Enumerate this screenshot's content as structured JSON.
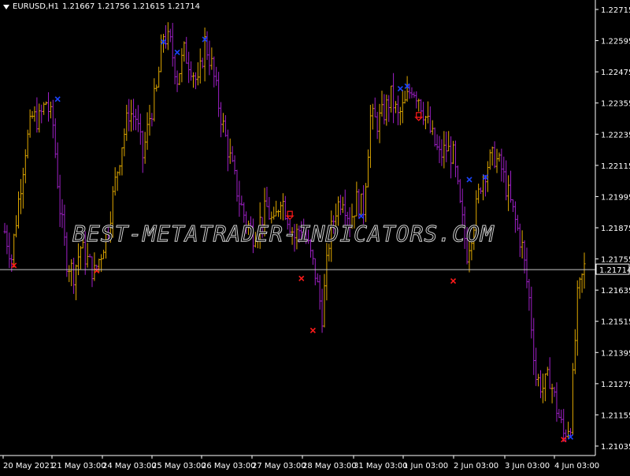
{
  "window": {
    "symbol": "EURUSD,H1",
    "ohlc": "1.21667 1.21756 1.21615 1.21714"
  },
  "watermark": "BEST-METATRADER-INDICATORS.COM",
  "price_axis": {
    "ticks": [
      "1.22715",
      "1.22595",
      "1.22475",
      "1.22355",
      "1.22235",
      "1.22115",
      "1.21995",
      "1.21875",
      "1.21755",
      "1.21635",
      "1.21515",
      "1.21395",
      "1.21275",
      "1.21155",
      "1.21035"
    ],
    "current_price_label": "1.21714"
  },
  "time_axis": {
    "ticks": [
      "20 May 2021",
      "21 May 03:00",
      "24 May 03:00",
      "25 May 03:00",
      "26 May 03:00",
      "27 May 03:00",
      "28 May 03:00",
      "31 May 03:00",
      "1 Jun 03:00",
      "2 Jun 03:00",
      "3 Jun 03:00",
      "4 Jun 03:00"
    ]
  },
  "colors": {
    "background": "#000000",
    "grid_text": "#ffffff",
    "bull_bar": "#e0a800",
    "bear_bar": "#a020c8",
    "current_line": "#c8c8c8",
    "sell_marker": "#ff1a1a",
    "buy_marker": "#1a44ff"
  },
  "chart_data": {
    "type": "bar",
    "title": "EURUSD,H1",
    "ylim": [
      1.21,
      1.2275
    ],
    "current_price": 1.21714,
    "xlabels": [
      "20 May 2021",
      "21 May 03:00",
      "24 May 03:00",
      "25 May 03:00",
      "26 May 03:00",
      "27 May 03:00",
      "28 May 03:00",
      "31 May 03:00",
      "1 Jun 03:00",
      "2 Jun 03:00",
      "3 Jun 03:00",
      "4 Jun 03:00"
    ],
    "close_path": [
      [
        0,
        1.2186
      ],
      [
        3,
        1.2176
      ],
      [
        6,
        1.2198
      ],
      [
        9,
        1.2218
      ],
      [
        12,
        1.223
      ],
      [
        15,
        1.2229
      ],
      [
        18,
        1.2236
      ],
      [
        21,
        1.2227
      ],
      [
        24,
        1.2195
      ],
      [
        27,
        1.2175
      ],
      [
        30,
        1.217
      ],
      [
        33,
        1.218
      ],
      [
        36,
        1.2175
      ],
      [
        39,
        1.217
      ],
      [
        42,
        1.2178
      ],
      [
        45,
        1.2188
      ],
      [
        48,
        1.2205
      ],
      [
        51,
        1.222
      ],
      [
        54,
        1.2232
      ],
      [
        57,
        1.223
      ],
      [
        60,
        1.2215
      ],
      [
        63,
        1.223
      ],
      [
        66,
        1.224
      ],
      [
        69,
        1.2262
      ],
      [
        72,
        1.2258
      ],
      [
        75,
        1.2245
      ],
      [
        78,
        1.2255
      ],
      [
        81,
        1.225
      ],
      [
        84,
        1.2242
      ],
      [
        87,
        1.2259
      ],
      [
        90,
        1.225
      ],
      [
        93,
        1.2235
      ],
      [
        96,
        1.2222
      ],
      [
        99,
        1.221
      ],
      [
        102,
        1.2198
      ],
      [
        105,
        1.219
      ],
      [
        108,
        1.2185
      ],
      [
        111,
        1.219
      ],
      [
        114,
        1.2195
      ],
      [
        117,
        1.2188
      ],
      [
        120,
        1.22
      ],
      [
        123,
        1.2192
      ],
      [
        126,
        1.2184
      ],
      [
        129,
        1.2188
      ],
      [
        132,
        1.218
      ],
      [
        135,
        1.217
      ],
      [
        138,
        1.2154
      ],
      [
        141,
        1.2182
      ],
      [
        144,
        1.2195
      ],
      [
        147,
        1.22
      ],
      [
        150,
        1.219
      ],
      [
        153,
        1.2198
      ],
      [
        156,
        1.2195
      ],
      [
        159,
        1.223
      ],
      [
        162,
        1.2228
      ],
      [
        165,
        1.2232
      ],
      [
        168,
        1.2238
      ],
      [
        171,
        1.223
      ],
      [
        174,
        1.2235
      ],
      [
        177,
        1.2242
      ],
      [
        180,
        1.2238
      ],
      [
        183,
        1.223
      ],
      [
        186,
        1.2222
      ],
      [
        189,
        1.2215
      ],
      [
        192,
        1.2218
      ],
      [
        195,
        1.2215
      ],
      [
        198,
        1.2195
      ],
      [
        201,
        1.2178
      ],
      [
        204,
        1.219
      ],
      [
        207,
        1.2205
      ],
      [
        210,
        1.2212
      ],
      [
        213,
        1.2215
      ],
      [
        216,
        1.221
      ],
      [
        219,
        1.22
      ],
      [
        222,
        1.219
      ],
      [
        225,
        1.218
      ],
      [
        228,
        1.216
      ],
      [
        231,
        1.213
      ],
      [
        234,
        1.2126
      ],
      [
        237,
        1.213
      ],
      [
        240,
        1.2118
      ],
      [
        243,
        1.2108
      ],
      [
        246,
        1.2113
      ],
      [
        249,
        1.216
      ],
      [
        252,
        1.2172
      ]
    ],
    "markers": [
      {
        "type": "sell",
        "x": 4,
        "price": 1.2173
      },
      {
        "type": "buy",
        "x": 23,
        "price": 1.2237
      },
      {
        "type": "sell",
        "x": 40,
        "price": 1.2171
      },
      {
        "type": "buy",
        "x": 69,
        "price": 1.2259
      },
      {
        "type": "buy",
        "x": 75,
        "price": 1.2255
      },
      {
        "type": "buy",
        "x": 87,
        "price": 1.226
      },
      {
        "type": "sell-open",
        "x": 124,
        "price": 1.2192
      },
      {
        "type": "sell",
        "x": 129,
        "price": 1.2168
      },
      {
        "type": "sell",
        "x": 134,
        "price": 1.2148
      },
      {
        "type": "buy",
        "x": 155,
        "price": 1.2192
      },
      {
        "type": "buy",
        "x": 172,
        "price": 1.2241
      },
      {
        "type": "buy",
        "x": 175,
        "price": 1.2242
      },
      {
        "type": "sell-open",
        "x": 180,
        "price": 1.223
      },
      {
        "type": "sell",
        "x": 195,
        "price": 1.2167
      },
      {
        "type": "buy",
        "x": 202,
        "price": 1.2206
      },
      {
        "type": "buy",
        "x": 209,
        "price": 1.2207
      },
      {
        "type": "sell",
        "x": 243,
        "price": 1.2106
      },
      {
        "type": "buy",
        "x": 246,
        "price": 1.2107
      }
    ]
  }
}
